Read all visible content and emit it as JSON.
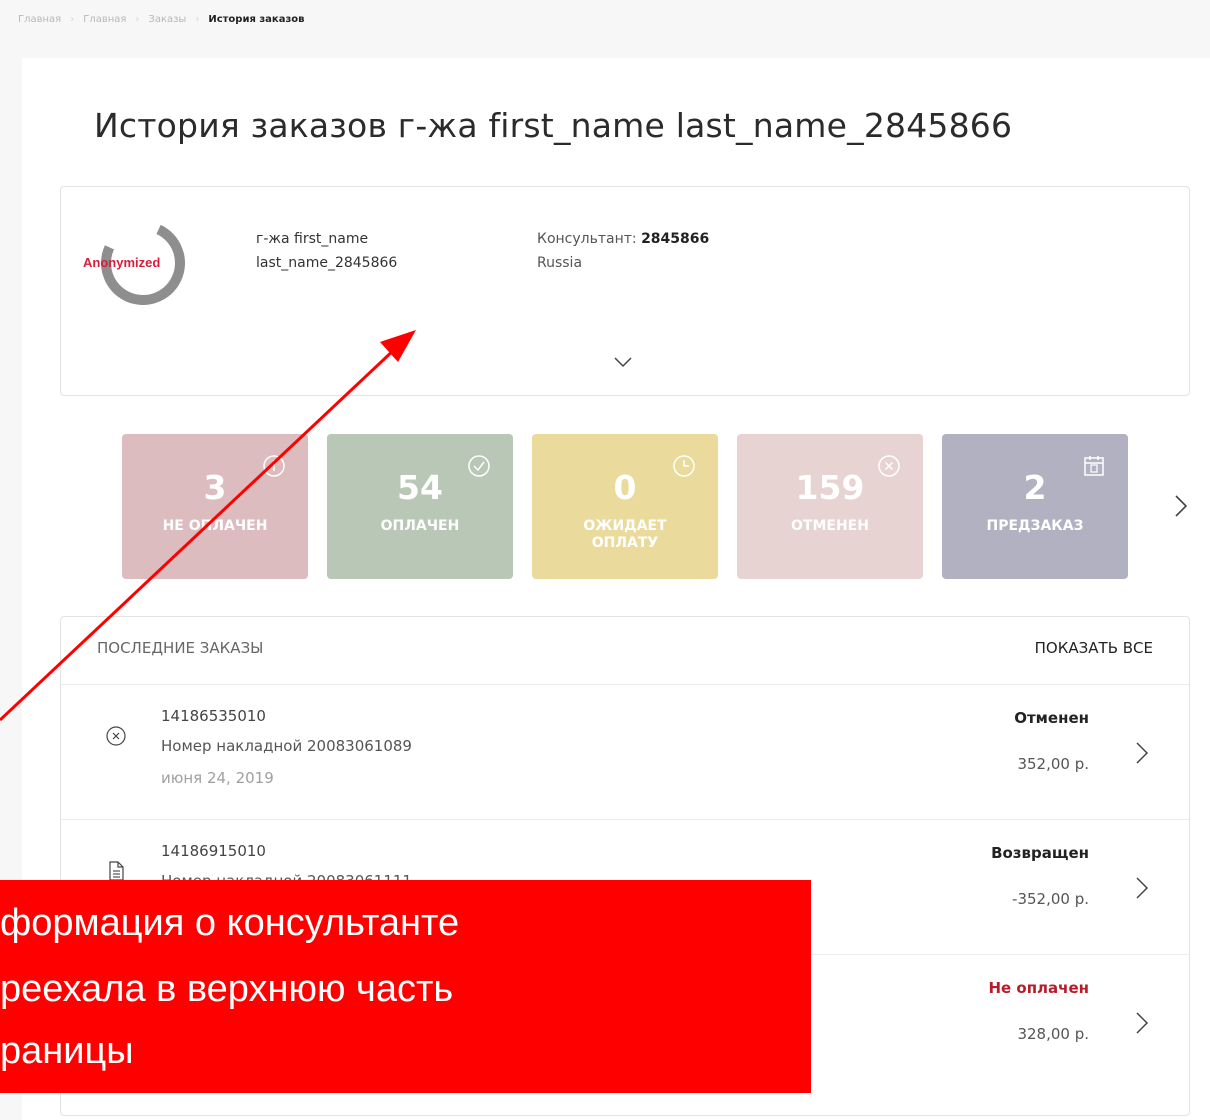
{
  "breadcrumb": {
    "items": [
      "Главная",
      "Главная",
      "Заказы"
    ],
    "current": "История заказов"
  },
  "page_title": "История заказов г-жа first_name last_name_2845866",
  "profile": {
    "avatar_text": "Anonymized",
    "name_line1": "г-жа first_name",
    "name_line2": "last_name_2845866",
    "consultant_label": "Консультант: ",
    "consultant_id": "2845866",
    "country": "Russia"
  },
  "tiles": [
    {
      "count": "3",
      "label": "НЕ ОПЛАЧЕН",
      "icon": "info-icon",
      "color": "#dcbcbe"
    },
    {
      "count": "54",
      "label": "ОПЛАЧЕН",
      "icon": "check-circle-icon",
      "color": "#b9c7b6"
    },
    {
      "count": "0",
      "label": "ОЖИДАЕТ ОПЛАТУ",
      "icon": "clock-icon",
      "color": "#eadb9c"
    },
    {
      "count": "159",
      "label": "ОТМЕНЕН",
      "icon": "x-circle-icon",
      "color": "#e6d3d2"
    },
    {
      "count": "2",
      "label": "ПРЕДЗАКАЗ",
      "icon": "calendar-icon",
      "color": "#b2b1c2"
    }
  ],
  "orders": {
    "title": "ПОСЛЕДНИЕ ЗАКАЗЫ",
    "show_all": "ПОКАЗАТЬ ВСЕ",
    "rows": [
      {
        "number": "14186535010",
        "waybill": "Номер накладной 20083061089",
        "date": "июня 24, 2019",
        "status": "Отменен",
        "price": "352,00 р.",
        "icon": "x-circle-icon"
      },
      {
        "number": "14186915010",
        "waybill": "Номер накладной 20083061111",
        "date": "",
        "status": "Возвращен",
        "price": "-352,00 р.",
        "icon": "document-icon"
      },
      {
        "number": "",
        "waybill": "",
        "date": "",
        "status": "Не оплачен",
        "price": "328,00 р.",
        "icon": ""
      }
    ]
  },
  "annotation": {
    "line1": "формация о консультанте",
    "line2": "реехала в верхнюю часть",
    "line3": "раницы",
    "color": "#ff0000"
  }
}
